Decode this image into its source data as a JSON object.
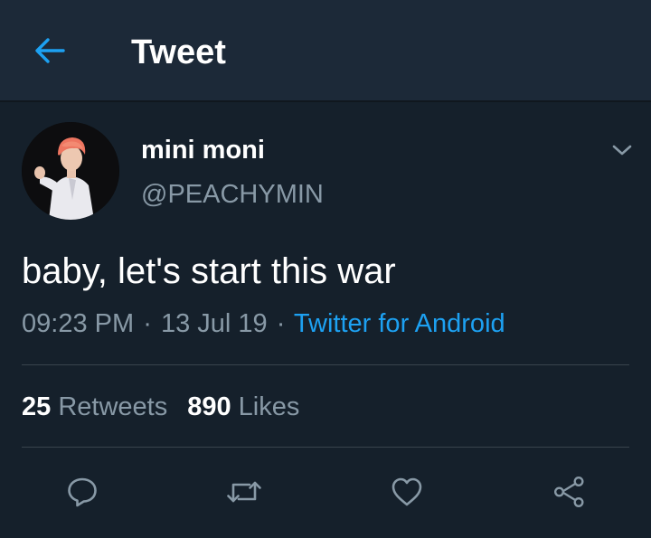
{
  "header": {
    "title": "Tweet",
    "back_icon": "arrow-left-icon"
  },
  "tweet": {
    "display_name": "mini moni",
    "handle": "@PEACHYMIN",
    "text": "baby, let's start this war",
    "time": "09:23 PM",
    "date": "13 Jul 19",
    "separator": "·",
    "source": "Twitter for Android",
    "avatar_icon": "avatar"
  },
  "stats": {
    "retweets_count": "25",
    "retweets_label": "Retweets",
    "likes_count": "890",
    "likes_label": "Likes"
  },
  "actions": [
    {
      "icon": "reply-icon"
    },
    {
      "icon": "retweet-icon"
    },
    {
      "icon": "heart-icon"
    },
    {
      "icon": "share-icon"
    }
  ],
  "colors": {
    "background": "#15202b",
    "header_background": "#1c2938",
    "accent": "#1da1f2",
    "secondary_text": "#8899a6",
    "divider": "#38444d"
  }
}
